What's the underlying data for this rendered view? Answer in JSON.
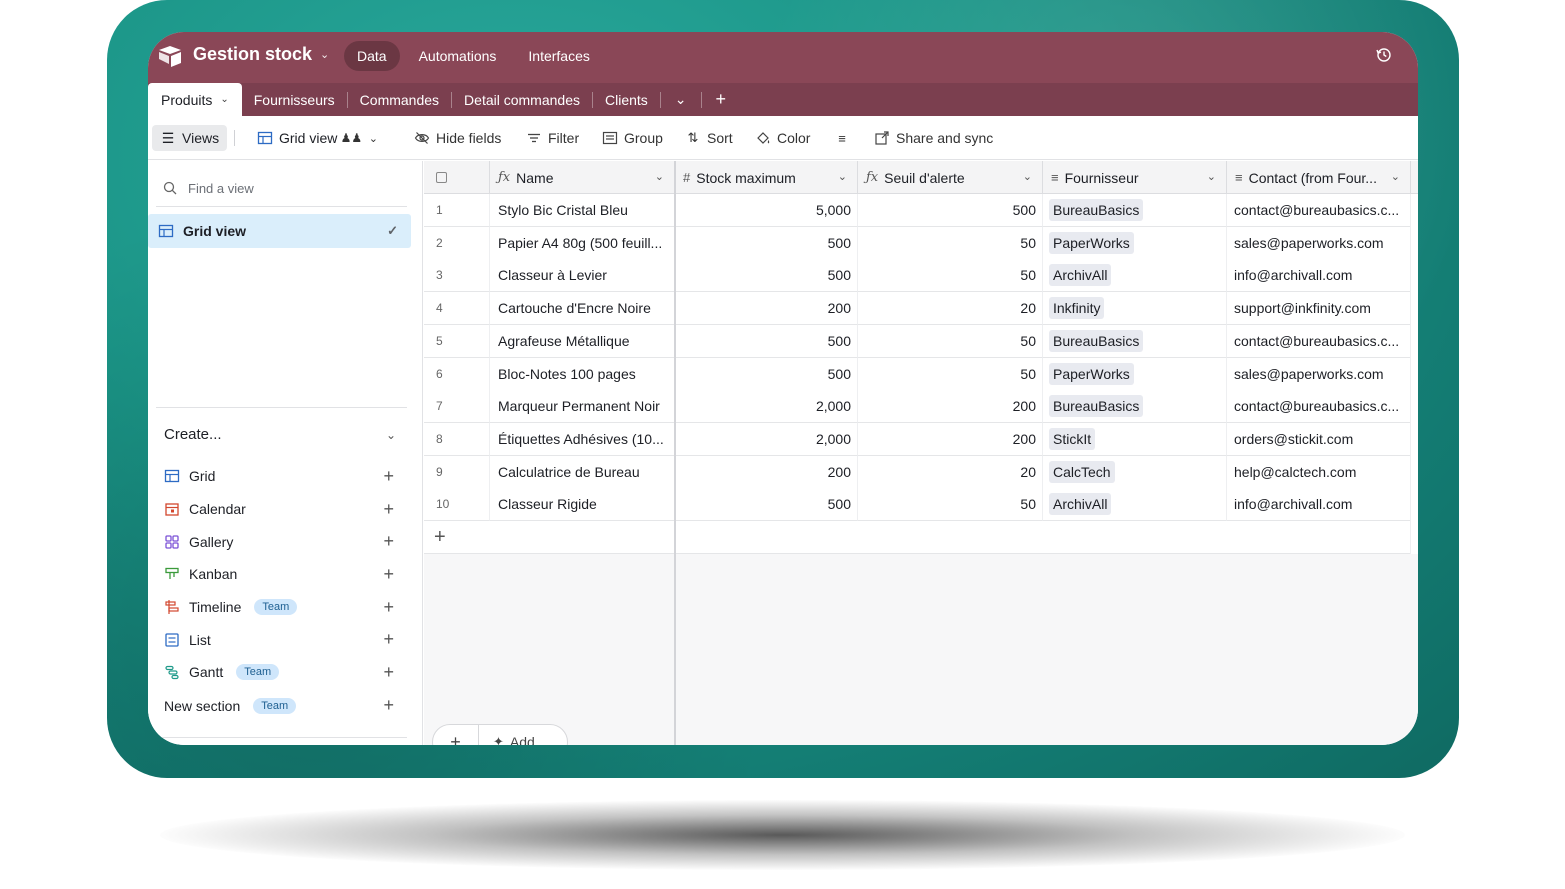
{
  "base": {
    "title": "Gestion stock",
    "nav": [
      "Data",
      "Automations",
      "Interfaces"
    ]
  },
  "tables": {
    "active": "Produits",
    "others": [
      "Fournisseurs",
      "Commandes",
      "Detail commandes",
      "Clients"
    ]
  },
  "toolbar": {
    "views": "Views",
    "grid_view": "Grid view",
    "hide_fields": "Hide fields",
    "filter": "Filter",
    "group": "Group",
    "sort": "Sort",
    "color": "Color",
    "share": "Share and sync"
  },
  "sidebar": {
    "find_placeholder": "Find a view",
    "active_view": "Grid view",
    "create_label": "Create...",
    "create_items": [
      {
        "label": "Grid",
        "badge": ""
      },
      {
        "label": "Calendar",
        "badge": ""
      },
      {
        "label": "Gallery",
        "badge": ""
      },
      {
        "label": "Kanban",
        "badge": ""
      },
      {
        "label": "Timeline",
        "badge": "Team"
      },
      {
        "label": "List",
        "badge": ""
      },
      {
        "label": "Gantt",
        "badge": "Team"
      },
      {
        "label": "New section",
        "badge": "Team"
      }
    ]
  },
  "grid": {
    "columns": {
      "name": "Name",
      "stock_max": "Stock maximum",
      "seuil": "Seuil d'alerte",
      "fournisseur": "Fournisseur",
      "contact": "Contact (from Four..."
    },
    "rows": [
      {
        "n": "1",
        "name": "Stylo Bic Cristal Bleu",
        "stock": "5,000",
        "seuil": "500",
        "fournisseur": "BureauBasics",
        "contact": "contact@bureaubasics.c..."
      },
      {
        "n": "2",
        "name": "Papier A4 80g (500 feuill...",
        "stock": "500",
        "seuil": "50",
        "fournisseur": "PaperWorks",
        "contact": "sales@paperworks.com"
      },
      {
        "n": "3",
        "name": "Classeur à Levier",
        "stock": "500",
        "seuil": "50",
        "fournisseur": "ArchivAll",
        "contact": "info@archivall.com"
      },
      {
        "n": "4",
        "name": "Cartouche d'Encre Noire",
        "stock": "200",
        "seuil": "20",
        "fournisseur": "Inkfinity",
        "contact": "support@inkfinity.com"
      },
      {
        "n": "5",
        "name": "Agrafeuse Métallique",
        "stock": "500",
        "seuil": "50",
        "fournisseur": "BureauBasics",
        "contact": "contact@bureaubasics.c..."
      },
      {
        "n": "6",
        "name": "Bloc-Notes 100 pages",
        "stock": "500",
        "seuil": "50",
        "fournisseur": "PaperWorks",
        "contact": "sales@paperworks.com"
      },
      {
        "n": "7",
        "name": "Marqueur Permanent Noir",
        "stock": "2,000",
        "seuil": "200",
        "fournisseur": "BureauBasics",
        "contact": "contact@bureaubasics.c..."
      },
      {
        "n": "8",
        "name": "Étiquettes Adhésives (10...",
        "stock": "2,000",
        "seuil": "200",
        "fournisseur": "StickIt",
        "contact": "orders@stickit.com"
      },
      {
        "n": "9",
        "name": "Calculatrice de Bureau",
        "stock": "200",
        "seuil": "20",
        "fournisseur": "CalcTech",
        "contact": "help@calctech.com"
      },
      {
        "n": "10",
        "name": "Classeur Rigide",
        "stock": "500",
        "seuil": "50",
        "fournisseur": "ArchivAll",
        "contact": "info@archivall.com"
      }
    ],
    "add_label": "Add"
  },
  "colors": {
    "topbar": "#8a4757",
    "tabbar": "#7b3f4f",
    "selected_view": "#daeefb",
    "frame": "#1a9486"
  }
}
